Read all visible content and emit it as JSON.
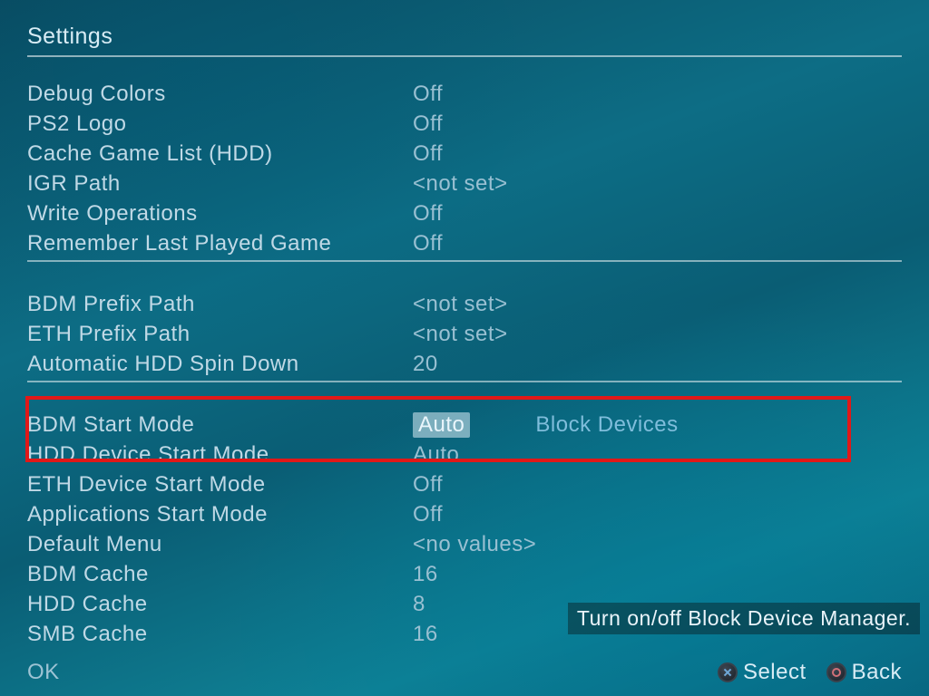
{
  "title": "Settings",
  "groups": {
    "g1": [
      {
        "label": "Debug Colors",
        "value": "Off"
      },
      {
        "label": "PS2 Logo",
        "value": "Off"
      },
      {
        "label": "Cache Game List (HDD)",
        "value": "Off"
      },
      {
        "label": "IGR Path",
        "value": "<not set>"
      },
      {
        "label": "Write Operations",
        "value": "Off"
      },
      {
        "label": "Remember Last Played Game",
        "value": "Off"
      }
    ],
    "g2": [
      {
        "label": "BDM Prefix Path",
        "value": "<not set>"
      },
      {
        "label": "ETH Prefix Path",
        "value": "<not set>"
      },
      {
        "label": "Automatic HDD Spin Down",
        "value": "20"
      }
    ],
    "g3": [
      {
        "label": "BDM Start Mode",
        "value": "Auto",
        "extra": "Block Devices",
        "selected": true
      },
      {
        "label": "HDD Device Start Mode",
        "value": "Auto"
      },
      {
        "label": "ETH Device Start Mode",
        "value": "Off"
      },
      {
        "label": "Applications Start Mode",
        "value": "Off"
      },
      {
        "label": "Default Menu",
        "value": "<no values>"
      },
      {
        "label": "BDM Cache",
        "value": "16"
      },
      {
        "label": "HDD Cache",
        "value": "8"
      },
      {
        "label": "SMB Cache",
        "value": "16"
      }
    ]
  },
  "tooltip": "Turn on/off Block Device Manager.",
  "footer": {
    "ok": "OK",
    "select": "Select",
    "back": "Back"
  }
}
